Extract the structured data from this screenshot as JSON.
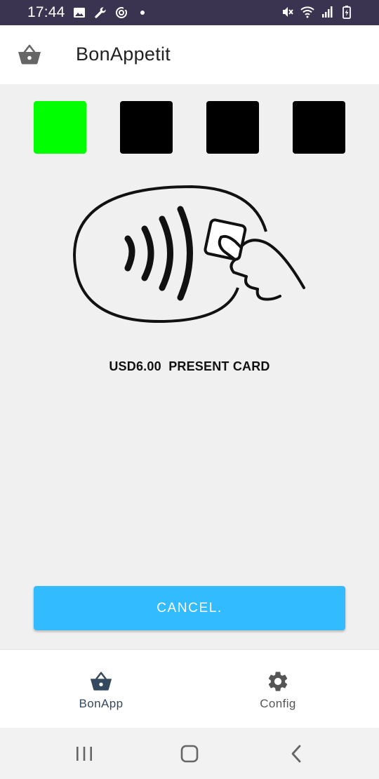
{
  "status_bar": {
    "time": "17:44",
    "left_icons": [
      "image-icon",
      "wrench-icon",
      "sync-icon",
      "dot-icon"
    ],
    "right_icons": [
      "mute-icon",
      "wifi-icon",
      "signal-icon",
      "battery-charging-icon"
    ]
  },
  "app_bar": {
    "icon": "basket-icon",
    "title": "BonAppetit"
  },
  "indicators": [
    {
      "state": "active",
      "color": "#00ff00"
    },
    {
      "state": "inactive",
      "color": "#000000"
    },
    {
      "state": "inactive",
      "color": "#000000"
    },
    {
      "state": "inactive",
      "color": "#000000"
    }
  ],
  "payment": {
    "illustration": "contactless-card-icon",
    "status_text": "USD6.00  PRESENT CARD"
  },
  "cancel_button": {
    "label": "CANCEL.",
    "color": "#33bbff"
  },
  "bottom_nav": {
    "items": [
      {
        "label": "BonApp",
        "icon": "basket-icon",
        "active": true
      },
      {
        "label": "Config",
        "icon": "gear-icon",
        "active": false
      }
    ]
  },
  "system_nav": {
    "buttons": [
      "recent-apps-icon",
      "home-icon",
      "back-icon"
    ]
  }
}
